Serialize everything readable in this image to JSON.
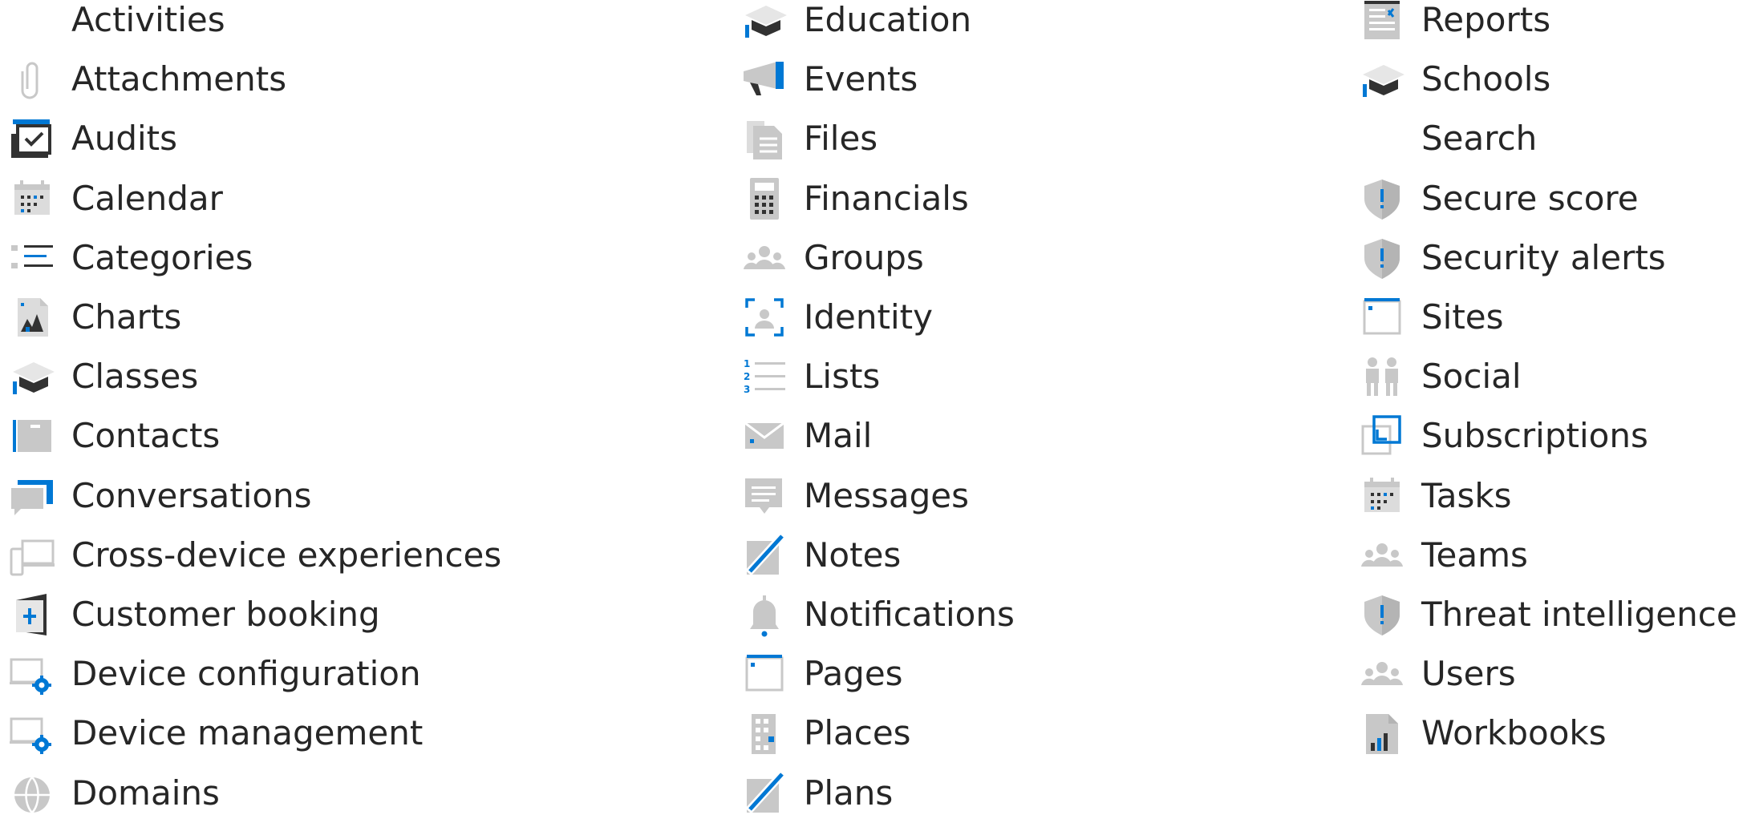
{
  "columns": [
    {
      "items": [
        {
          "label": "Activities",
          "icon": "none"
        },
        {
          "label": "Attachments",
          "icon": "paperclip-icon"
        },
        {
          "label": "Audits",
          "icon": "audit-check-icon"
        },
        {
          "label": "Calendar",
          "icon": "calendar-icon"
        },
        {
          "label": "Categories",
          "icon": "categories-list-icon"
        },
        {
          "label": "Charts",
          "icon": "chart-document-icon"
        },
        {
          "label": "Classes",
          "icon": "graduation-cap-icon"
        },
        {
          "label": "Contacts",
          "icon": "contact-card-icon"
        },
        {
          "label": "Conversations",
          "icon": "conversation-icon"
        },
        {
          "label": "Cross-device experiences",
          "icon": "devices-icon"
        },
        {
          "label": "Customer booking",
          "icon": "booking-icon"
        },
        {
          "label": "Device configuration",
          "icon": "device-gear-icon"
        },
        {
          "label": "Device management",
          "icon": "device-gear-icon"
        },
        {
          "label": "Domains",
          "icon": "globe-icon"
        }
      ]
    },
    {
      "items": [
        {
          "label": "Education",
          "icon": "graduation-cap-icon"
        },
        {
          "label": "Events",
          "icon": "megaphone-icon"
        },
        {
          "label": "Files",
          "icon": "files-icon"
        },
        {
          "label": "Financials",
          "icon": "calculator-icon"
        },
        {
          "label": "Groups",
          "icon": "people-group-icon"
        },
        {
          "label": "Identity",
          "icon": "identity-frame-icon"
        },
        {
          "label": "Lists",
          "icon": "numbered-list-icon"
        },
        {
          "label": "Mail",
          "icon": "envelope-icon"
        },
        {
          "label": "Messages",
          "icon": "message-icon"
        },
        {
          "label": "Notes",
          "icon": "pen-note-icon"
        },
        {
          "label": "Notifications",
          "icon": "bell-icon"
        },
        {
          "label": "Pages",
          "icon": "page-window-icon"
        },
        {
          "label": "Places",
          "icon": "building-icon"
        },
        {
          "label": "Plans",
          "icon": "pen-note-icon"
        }
      ]
    },
    {
      "items": [
        {
          "label": "Reports",
          "icon": "report-icon"
        },
        {
          "label": "Schools",
          "icon": "graduation-cap-icon"
        },
        {
          "label": "Search",
          "icon": "none"
        },
        {
          "label": "Secure score",
          "icon": "shield-alert-icon"
        },
        {
          "label": "Security alerts",
          "icon": "shield-alert-icon"
        },
        {
          "label": "Sites",
          "icon": "page-window-icon"
        },
        {
          "label": "Social",
          "icon": "two-people-icon"
        },
        {
          "label": "Subscriptions",
          "icon": "subscription-icon"
        },
        {
          "label": "Tasks",
          "icon": "calendar-icon"
        },
        {
          "label": "Teams",
          "icon": "people-group-icon"
        },
        {
          "label": "Threat intelligence",
          "icon": "shield-alert-icon"
        },
        {
          "label": "Users",
          "icon": "people-group-icon"
        },
        {
          "label": "Workbooks",
          "icon": "workbook-chart-icon"
        }
      ]
    }
  ],
  "colors": {
    "gray": "#c8c8c8",
    "dark": "#323232",
    "blue": "#0078d4",
    "text": "#262626"
  }
}
